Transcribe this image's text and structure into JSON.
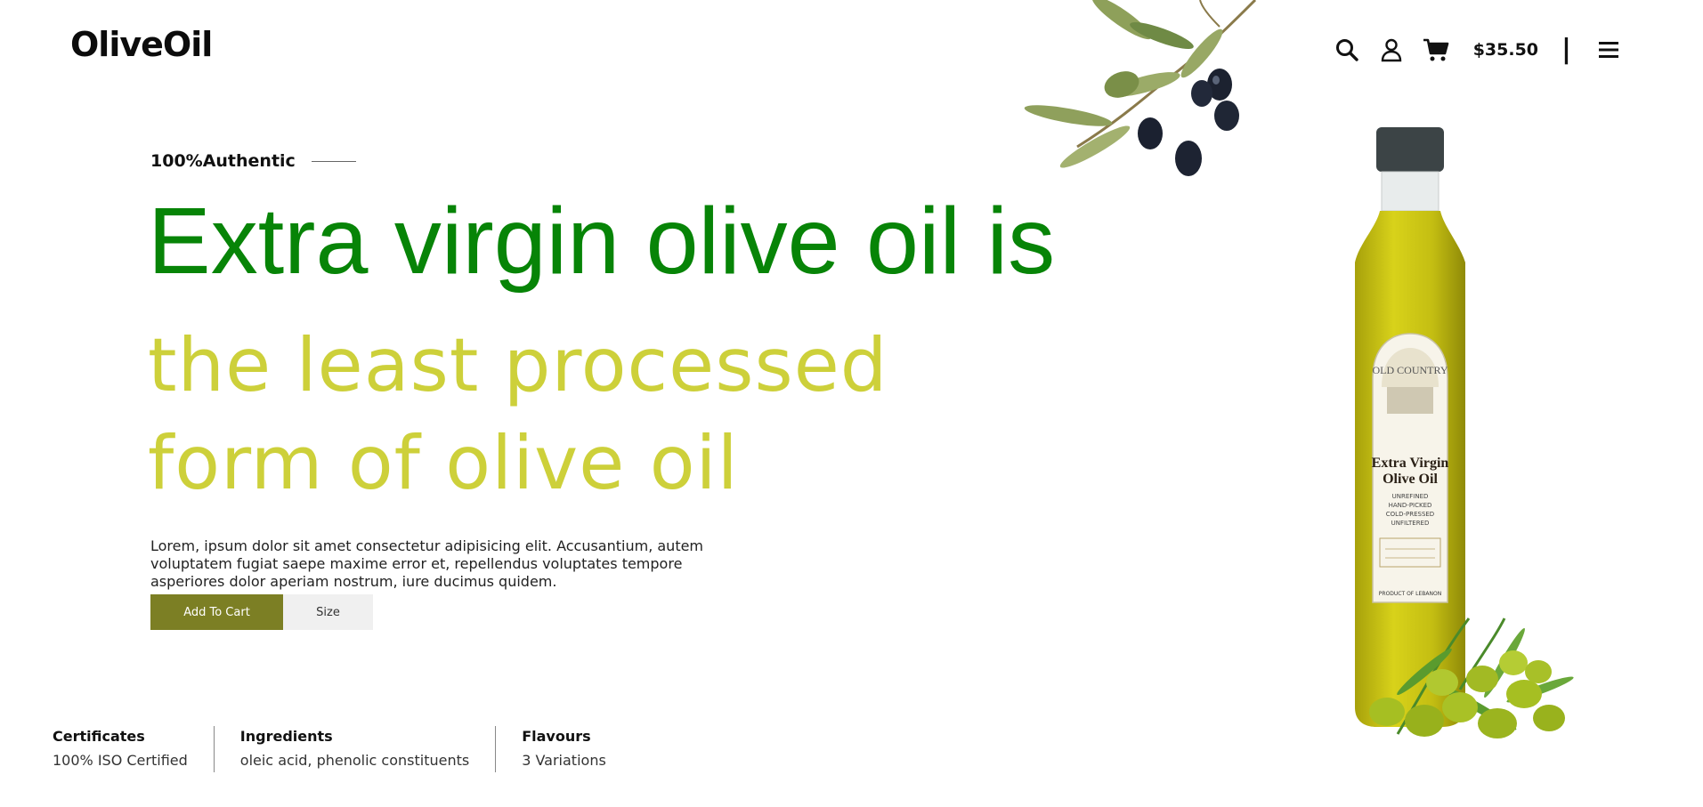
{
  "header": {
    "logo": "OliveOil",
    "cart_total": "$35.50",
    "separator": "|",
    "icons": [
      "search-icon",
      "user-icon",
      "cart-icon",
      "menu-icon"
    ]
  },
  "hero": {
    "eyebrow": "100%Authentic",
    "headline_line1": "Extra virgin olive oil is",
    "headline_line2": "the least processed form of olive oil",
    "description": "Lorem, ipsum dolor sit amet consectetur adipisicing elit. Accusantium, autem voluptatem fugiat saepe maxime error et, repellendus voluptates tempore asperiores dolor aperiam nostrum, iure ducimus quidem.",
    "add_to_cart_label": "Add To Cart",
    "size_label": "Size"
  },
  "features": [
    {
      "title": "Certificates",
      "value": "100% ISO Certified"
    },
    {
      "title": "Ingredients",
      "value": "oleic acid, phenolic constituents"
    },
    {
      "title": "Flavours",
      "value": "3 Variations"
    }
  ],
  "bottle_label": {
    "brand": "OLD COUNTRY",
    "line1": "Extra Virgin",
    "line2": "Olive Oil",
    "details": [
      "UNREFINED",
      "HAND-PICKED",
      "COLD-PRESSED",
      "UNFILTERED"
    ],
    "footer": "PRODUCT OF LEBANON"
  },
  "colors": {
    "headline_green": "#078407",
    "headline_yellow": "#cdd03a",
    "button_olive": "#7c7f24"
  }
}
